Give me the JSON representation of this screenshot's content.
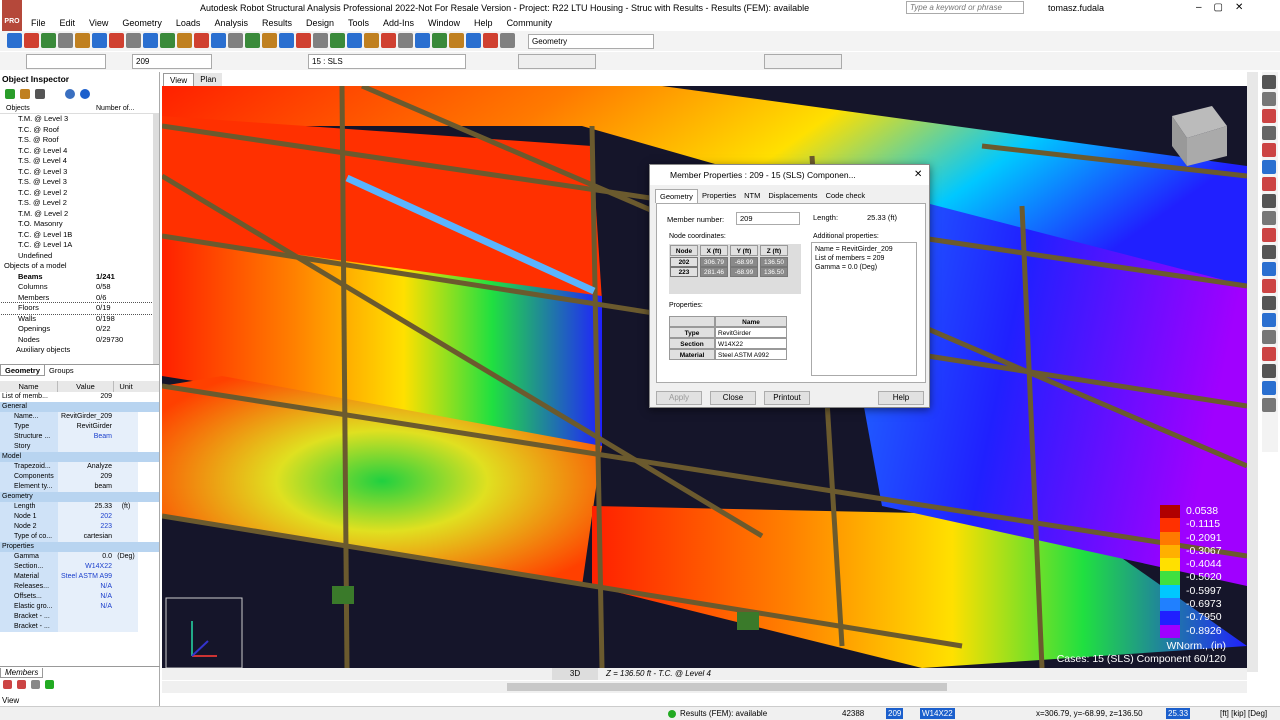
{
  "app": {
    "title": "Autodesk Robot Structural Analysis Professional 2022-Not For Resale Version - Project: R22 LTU Housing - Struc with Results - Results (FEM): available",
    "search_placeholder": "Type a keyword or phrase",
    "user": "tomasz.fudala",
    "logo": "PRO"
  },
  "menu": [
    "File",
    "Edit",
    "View",
    "Geometry",
    "Loads",
    "Analysis",
    "Results",
    "Design",
    "Tools",
    "Add-Ins",
    "Window",
    "Help",
    "Community"
  ],
  "toolbar": {
    "layout_combo": "Geometry",
    "selection_value": "209",
    "case_combo": "15 : SLS"
  },
  "inspector": {
    "title": "Object Inspector",
    "col_objects": "Objects",
    "col_number": "Number of...",
    "tree": [
      {
        "label": "T.M. @ Level 3",
        "count": ""
      },
      {
        "label": "T.C. @ Roof",
        "count": ""
      },
      {
        "label": "T.S. @ Roof",
        "count": ""
      },
      {
        "label": "T.C. @ Level 4",
        "count": ""
      },
      {
        "label": "T.S. @ Level 4",
        "count": ""
      },
      {
        "label": "T.C. @ Level 3",
        "count": ""
      },
      {
        "label": "T.S. @ Level 3",
        "count": ""
      },
      {
        "label": "T.C. @ Level 2",
        "count": ""
      },
      {
        "label": "T.S. @ Level 2",
        "count": ""
      },
      {
        "label": "T.M. @ Level 2",
        "count": ""
      },
      {
        "label": "T.O. Masonry",
        "count": ""
      },
      {
        "label": "T.C. @ Level 1B",
        "count": ""
      },
      {
        "label": "T.C. @ Level 1A",
        "count": ""
      },
      {
        "label": "Undefined",
        "count": ""
      },
      {
        "label": "Objects of a model",
        "count": ""
      },
      {
        "label": "Beams",
        "count": "1/241"
      },
      {
        "label": "Columns",
        "count": "0/58"
      },
      {
        "label": "Members",
        "count": "0/6"
      },
      {
        "label": "Floors",
        "count": "0/19"
      },
      {
        "label": "Walls",
        "count": "0/198"
      },
      {
        "label": "Openings",
        "count": "0/22"
      },
      {
        "label": "Nodes",
        "count": "0/29730"
      },
      {
        "label": "Auxiliary objects",
        "count": ""
      }
    ],
    "tabs": [
      "Geometry",
      "Groups"
    ],
    "grid_headers": [
      "Name",
      "Value",
      "Unit"
    ],
    "grid": [
      {
        "name": "List of memb...",
        "value": "209",
        "unit": "",
        "kind": "plain"
      },
      {
        "name": "General",
        "value": "",
        "unit": "",
        "kind": "section"
      },
      {
        "name": "Name...",
        "value": "RevitGirder_209",
        "unit": "",
        "kind": "item"
      },
      {
        "name": "Type",
        "value": "RevitGirder",
        "unit": "",
        "kind": "item"
      },
      {
        "name": "Structure ...",
        "value": "Beam",
        "unit": "",
        "kind": "item"
      },
      {
        "name": "Story",
        "value": "",
        "unit": "",
        "kind": "item"
      },
      {
        "name": "Model",
        "value": "",
        "unit": "",
        "kind": "section"
      },
      {
        "name": "Trapezoid...",
        "value": "Analyze",
        "unit": "",
        "kind": "item"
      },
      {
        "name": "Components",
        "value": "209",
        "unit": "",
        "kind": "item"
      },
      {
        "name": "Element ty...",
        "value": "beam",
        "unit": "",
        "kind": "item"
      },
      {
        "name": "Geometry",
        "value": "",
        "unit": "",
        "kind": "section"
      },
      {
        "name": "Length",
        "value": "25.33",
        "unit": "(ft)",
        "kind": "item"
      },
      {
        "name": "Node 1",
        "value": "202",
        "unit": "",
        "kind": "item"
      },
      {
        "name": "Node 2",
        "value": "223",
        "unit": "",
        "kind": "item"
      },
      {
        "name": "Type of co...",
        "value": "cartesian",
        "unit": "",
        "kind": "item"
      },
      {
        "name": "Properties",
        "value": "",
        "unit": "",
        "kind": "section"
      },
      {
        "name": "Gamma",
        "value": "0.0",
        "unit": "(Deg)",
        "kind": "item"
      },
      {
        "name": "Section...",
        "value": "W14X22",
        "unit": "",
        "kind": "item"
      },
      {
        "name": "Material",
        "value": "Steel ASTM A99",
        "unit": "",
        "kind": "item"
      },
      {
        "name": "Releases...",
        "value": "N/A",
        "unit": "",
        "kind": "item"
      },
      {
        "name": "Offsets...",
        "value": "N/A",
        "unit": "",
        "kind": "item"
      },
      {
        "name": "Elastic gro...",
        "value": "N/A",
        "unit": "",
        "kind": "item"
      },
      {
        "name": "Bracket - ...",
        "value": "",
        "unit": "",
        "kind": "item"
      },
      {
        "name": "Bracket - ...",
        "value": "",
        "unit": "",
        "kind": "item"
      }
    ],
    "bottom_tab": "Members",
    "view_label": "View"
  },
  "viewtabs": [
    "View",
    "Plan"
  ],
  "dialog": {
    "title": "Member Properties : 209 - 15 (SLS) Componen...",
    "tabs": [
      "Geometry",
      "Properties",
      "NTM",
      "Displacements",
      "Code check"
    ],
    "member_number_label": "Member number:",
    "member_number": "209",
    "length_label": "Length:",
    "length_value": "25.33 (ft)",
    "node_coords_label": "Node coordinates:",
    "node_headers": [
      "Node",
      "X (ft)",
      "Y (ft)",
      "Z (ft)"
    ],
    "nodes": [
      [
        "202",
        "306.79",
        "-68.99",
        "136.50"
      ],
      [
        "223",
        "281.46",
        "-68.99",
        "136.50"
      ]
    ],
    "additional_label": "Additional properties:",
    "additional": [
      "Name = RevitGirder_209",
      "List of members = 209",
      "Gamma = 0.0 (Deg)"
    ],
    "properties_label": "Properties:",
    "prop_header": "Name",
    "props": [
      [
        "Type",
        "RevitGirder"
      ],
      [
        "Section",
        "W14X22"
      ],
      [
        "Material",
        "Steel ASTM A992"
      ]
    ],
    "buttons": {
      "apply": "Apply",
      "close": "Close",
      "printout": "Printout",
      "help": "Help"
    }
  },
  "legend": {
    "values": [
      "0.0538",
      "-0.1115",
      "-0.2091",
      "-0.3067",
      "-0.4044",
      "-0.5020",
      "-0.5997",
      "-0.6973",
      "-0.7950",
      "-0.8926"
    ],
    "colors": [
      "#b00000",
      "#ff3000",
      "#ff7a00",
      "#ffb000",
      "#ffe000",
      "#40e040",
      "#00c8ff",
      "#2080ff",
      "#2020ff",
      "#a000ff"
    ],
    "caption": "WNorm., (in)",
    "cases": "Cases: 15 (SLS) Component 60/120"
  },
  "bottom_nav": {
    "mode": "3D",
    "level": "Z = 136.50 ft - T.C. @ Level 4"
  },
  "status": {
    "results": "Results (FEM): available",
    "count": "42388",
    "member": "209",
    "section": "W14X22",
    "coords": "x=306.79, y=-68.99, z=136.50",
    "value": "25.33",
    "units": "[ft] [kip] [Deg]"
  },
  "colors": {
    "accent": "#0078d7",
    "selection": "#5ab4ff",
    "frame": "#6b5a2e"
  }
}
